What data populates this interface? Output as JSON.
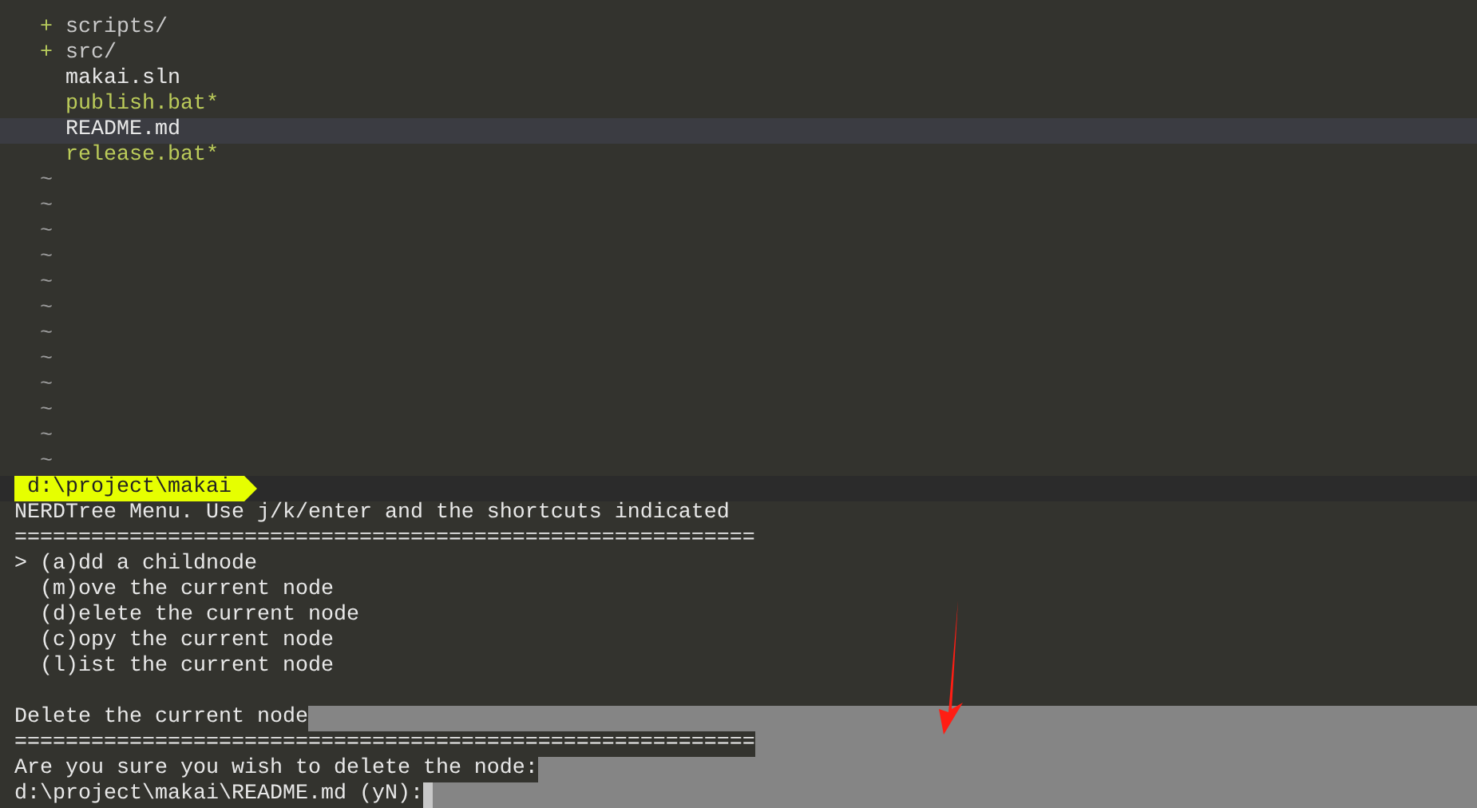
{
  "tree": [
    {
      "kind": "dir",
      "marker": "+",
      "name": "scripts/",
      "selected": false
    },
    {
      "kind": "dir",
      "marker": "+",
      "name": "src/",
      "selected": false
    },
    {
      "kind": "file",
      "name": "makai.sln",
      "selected": false
    },
    {
      "kind": "exec",
      "name": "publish.bat*",
      "selected": false
    },
    {
      "kind": "file",
      "name": "README.md",
      "selected": true
    },
    {
      "kind": "exec",
      "name": "release.bat*",
      "selected": false
    }
  ],
  "filler": [
    "~",
    "~",
    "~",
    "~",
    "~",
    "~",
    "~",
    "~",
    "~",
    "~",
    "~",
    "~"
  ],
  "status_line": {
    "path": "d:\\project\\makai"
  },
  "menu": {
    "title": "NERDTree Menu. Use j/k/enter and the shortcuts indicated",
    "rule": "==========================================================",
    "pointer": ">",
    "items": [
      {
        "label": "(a)dd a childnode",
        "selected": true
      },
      {
        "label": "(m)ove the current node",
        "selected": false
      },
      {
        "label": "(d)elete the current node",
        "selected": false
      },
      {
        "label": "(c)opy the current node",
        "selected": false
      },
      {
        "label": "(l)ist the current node",
        "selected": false
      }
    ]
  },
  "prompt": {
    "title": "Delete the current node",
    "rule": "==========================================================",
    "question": "Are you sure you wish to delete the node:",
    "input": "d:\\project\\makai\\README.md (yN):"
  }
}
